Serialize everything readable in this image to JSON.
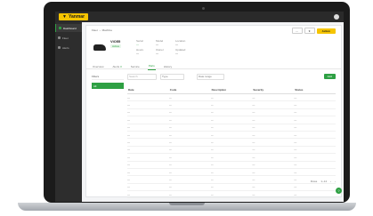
{
  "app": {
    "logo_text": "Yanmar",
    "brand_color": "#f5c400",
    "accent_color": "#2ea043"
  },
  "sidebar": {
    "items": [
      {
        "label": "Dashboard",
        "active": true
      },
      {
        "label": "Fleet",
        "active": false
      },
      {
        "label": "Alerts",
        "active": false
      }
    ]
  },
  "breadcrumb": [
    "Fleet",
    "Machine"
  ],
  "header_actions": {
    "icon_btn_1": "⋯",
    "icon_btn_2": "★",
    "primary_label": "Action"
  },
  "machine": {
    "name": "ViO55",
    "status": "Active",
    "meta": [
      {
        "label": "Serial",
        "value": "—"
      },
      {
        "label": "Model",
        "value": "—"
      },
      {
        "label": "Location",
        "value": "—"
      },
      {
        "label": "Hours",
        "value": "—"
      },
      {
        "label": "Owner",
        "value": "—"
      },
      {
        "label": "Updated",
        "value": "—"
      }
    ]
  },
  "tabs": [
    {
      "label": "Overview",
      "count": ""
    },
    {
      "label": "Alerts",
      "count": "3"
    },
    {
      "label": "Service",
      "count": ""
    },
    {
      "label": "Parts",
      "count": ""
    },
    {
      "label": "History",
      "count": ""
    }
  ],
  "filters": {
    "title": "Filters",
    "active": "All"
  },
  "toolbar": {
    "search_placeholder": "Search",
    "select_1": "Type",
    "select_2": "Date range",
    "add_label": "Add"
  },
  "table": {
    "columns": [
      "Date",
      "Code",
      "Description",
      "Severity",
      "Status"
    ],
    "rows": [
      [
        "—",
        "—",
        "—",
        "—",
        "—"
      ],
      [
        "—",
        "—",
        "—",
        "—",
        "—"
      ],
      [
        "—",
        "—",
        "—",
        "—",
        "—"
      ],
      [
        "—",
        "—",
        "—",
        "—",
        "—"
      ],
      [
        "—",
        "—",
        "—",
        "—",
        "—"
      ],
      [
        "—",
        "—",
        "—",
        "—",
        "—"
      ],
      [
        "—",
        "—",
        "—",
        "—",
        "—"
      ],
      [
        "—",
        "—",
        "—",
        "—",
        "—"
      ],
      [
        "—",
        "—",
        "—",
        "—",
        "—"
      ],
      [
        "—",
        "—",
        "—",
        "—",
        "—"
      ],
      [
        "—",
        "—",
        "—",
        "—",
        "—"
      ],
      [
        "—",
        "—",
        "—",
        "—",
        "—"
      ],
      [
        "—",
        "—",
        "—",
        "—",
        "—"
      ],
      [
        "—",
        "—",
        "—",
        "—",
        "—"
      ]
    ]
  },
  "pagination": {
    "rows_label": "Rows",
    "range": "1–14"
  },
  "fab_label": "?"
}
